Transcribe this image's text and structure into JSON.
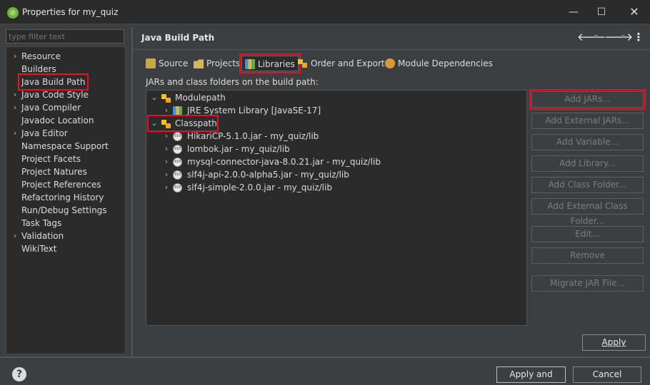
{
  "window": {
    "title": "Properties for my_quiz",
    "icon": "spring-leaf-icon",
    "controls": {
      "menu": "⋮",
      "minimize": "—",
      "maximize": "☐",
      "close": "✕"
    }
  },
  "filter": {
    "placeholder": "type filter text",
    "value": ""
  },
  "sidebar": {
    "items": [
      {
        "label": "Resource",
        "expandable": true
      },
      {
        "label": "Builders",
        "expandable": false
      },
      {
        "label": "Java Build Path",
        "expandable": false,
        "selected": true
      },
      {
        "label": "Java Code Style",
        "expandable": true
      },
      {
        "label": "Java Compiler",
        "expandable": true
      },
      {
        "label": "Javadoc Location",
        "expandable": false
      },
      {
        "label": "Java Editor",
        "expandable": true
      },
      {
        "label": "Namespace Support",
        "expandable": false
      },
      {
        "label": "Project Facets",
        "expandable": false
      },
      {
        "label": "Project Natures",
        "expandable": false
      },
      {
        "label": "Project References",
        "expandable": false
      },
      {
        "label": "Refactoring History",
        "expandable": false
      },
      {
        "label": "Run/Debug Settings",
        "expandable": false
      },
      {
        "label": "Task Tags",
        "expandable": false
      },
      {
        "label": "Validation",
        "expandable": true
      },
      {
        "label": "WikiText",
        "expandable": false
      }
    ]
  },
  "page": {
    "title": "Java Build Path"
  },
  "tabs": [
    {
      "label": "Source",
      "icon": "source-folder-icon"
    },
    {
      "label": "Projects",
      "icon": "projects-icon"
    },
    {
      "label": "Libraries",
      "icon": "libraries-icon",
      "active": true
    },
    {
      "label": "Order and Export",
      "icon": "order-export-icon"
    },
    {
      "label": "Module Dependencies",
      "icon": "module-icon"
    }
  ],
  "build_path": {
    "subtitle": "JARs and class folders on the build path:",
    "modulepath": {
      "label": "Modulepath",
      "children": [
        "JRE System Library [JavaSE-17]"
      ]
    },
    "classpath": {
      "label": "Classpath",
      "children": [
        "HikariCP-5.1.0.jar - my_quiz/lib",
        "lombok.jar - my_quiz/lib",
        "mysql-connector-java-8.0.21.jar - my_quiz/lib",
        "slf4j-api-2.0.0-alpha5.jar - my_quiz/lib",
        "slf4j-simple-2.0.0.jar - my_quiz/lib"
      ]
    }
  },
  "side_buttons": {
    "add_jars": "Add JARs...",
    "add_external_jars": "Add External JARs...",
    "add_variable": "Add Variable...",
    "add_library": "Add Library...",
    "add_class_folder": "Add Class Folder...",
    "add_external_class_folder": "Add External Class Folder...",
    "edit": "Edit...",
    "remove": "Remove",
    "migrate_jar": "Migrate JAR File..."
  },
  "footer": {
    "apply": "Apply",
    "apply_and_close": "Apply and Close",
    "cancel": "Cancel"
  },
  "colors": {
    "highlight": "#e81123",
    "background": "#3c3f41",
    "panel": "#2b2b2b"
  }
}
